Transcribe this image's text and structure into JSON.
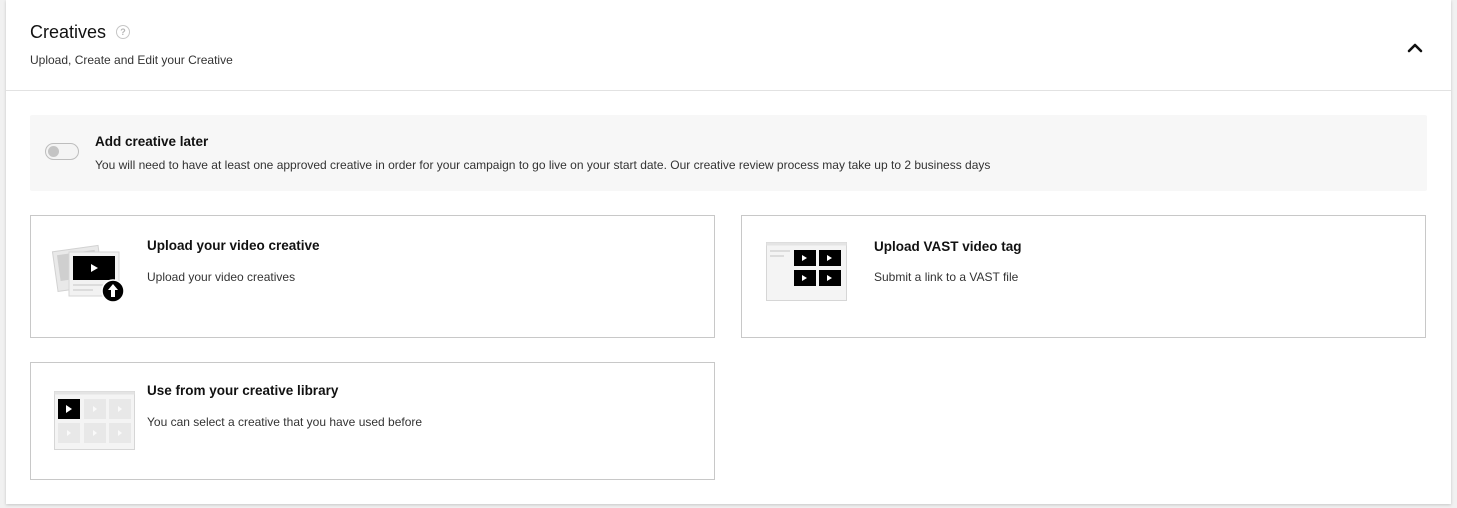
{
  "section": {
    "title": "Creatives",
    "help_glyph": "?",
    "subtitle": "Upload, Create and Edit your Creative",
    "collapse_icon": "chevron-up-icon"
  },
  "add_later": {
    "title": "Add creative later",
    "description": "You will need to have at least one approved creative in order for your campaign to go live on your start date. Our creative review process may take up to 2 business days",
    "toggle_on": false
  },
  "options": [
    {
      "title": "Upload your video creative",
      "description": "Upload your video creatives",
      "icon": "upload-video-illustration"
    },
    {
      "title": "Upload VAST video tag",
      "description": "Submit a link to a VAST file",
      "icon": "vast-tag-illustration"
    },
    {
      "title": "Use from your creative library",
      "description": "You can select a creative that you have used before",
      "icon": "creative-library-illustration"
    }
  ],
  "colors": {
    "accent": "#000000",
    "notice_bg": "#f7f7f7",
    "border": "#c8c8c8"
  }
}
